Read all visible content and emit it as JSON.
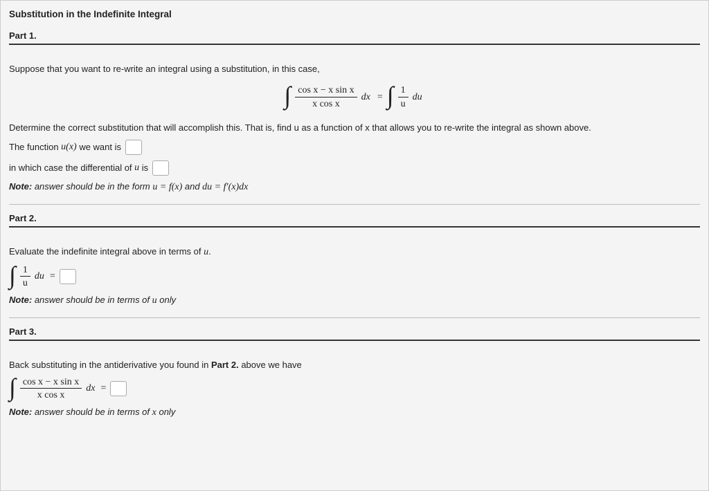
{
  "title": "Substitution in the Indefinite Integral",
  "part1": {
    "heading": "Part 1.",
    "intro": "Suppose that you want to re-write an integral using a substitution, in this case,",
    "eq_lhs_num": "cos x − x sin x",
    "eq_lhs_den": "x cos x",
    "eq_dx": "dx",
    "eq_equals": "=",
    "eq_rhs_num": "1",
    "eq_rhs_den": "u",
    "eq_du": "du",
    "determine": "Determine the correct substitution that will accomplish this. That is, find u as a function of x that allows you to re-write the integral as shown above.",
    "func_prefix": "The function ",
    "func_ux": "u(x)",
    "func_suffix": " we want is ",
    "diff_prefix": "in which case the differential of ",
    "diff_u": "u",
    "diff_suffix": " is ",
    "note_label": "Note:",
    "note_text": " answer should be in the form ",
    "note_eq1": "u = f(x)",
    "note_and": " and ",
    "note_eq2": "du = f′(x)dx"
  },
  "part2": {
    "heading": "Part 2.",
    "intro": "Evaluate the indefinite integral above in terms of ",
    "intro_u": "u",
    "intro_suffix": ".",
    "eq_num": "1",
    "eq_den": "u",
    "eq_du": "du",
    "eq_equals": "=",
    "note_label": "Note:",
    "note_text": " answer should be in terms of ",
    "note_u": "u",
    "note_suffix": " only"
  },
  "part3": {
    "heading": "Part 3.",
    "intro_a": "Back substituting in the antiderivative you found in ",
    "intro_bold": "Part 2.",
    "intro_b": " above we have",
    "eq_num": "cos x − x sin x",
    "eq_den": "x cos x",
    "eq_dx": "dx",
    "eq_equals": "=",
    "note_label": "Note:",
    "note_text": " answer should be in terms of ",
    "note_x": "x",
    "note_suffix": " only"
  }
}
